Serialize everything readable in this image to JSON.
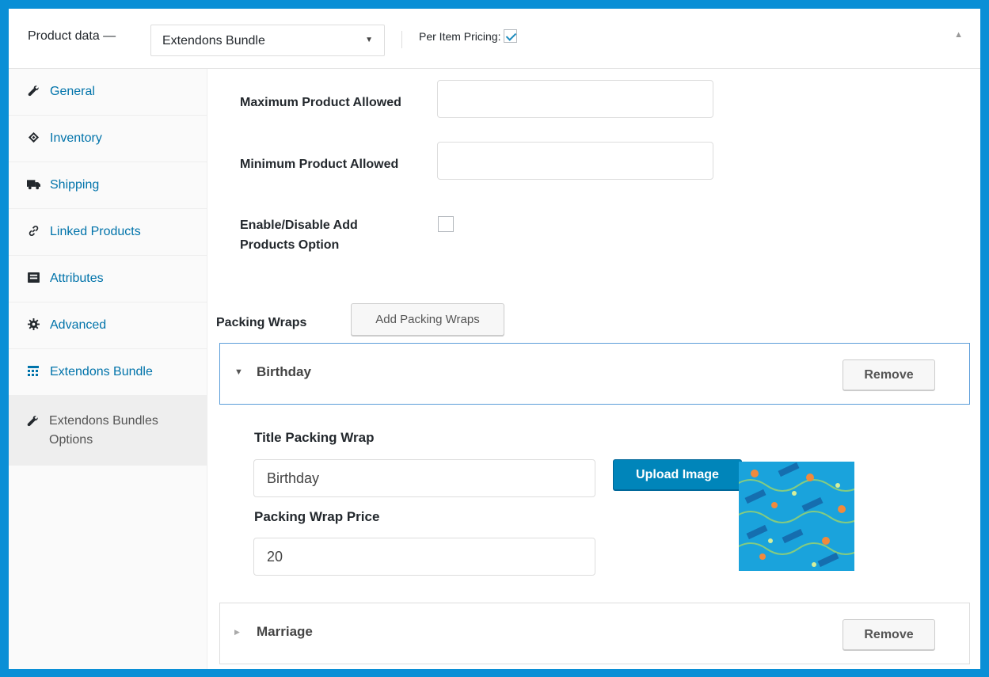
{
  "header": {
    "label": "Product data —",
    "product_type": "Extendons Bundle",
    "per_item_pricing_label": "Per Item Pricing:",
    "per_item_pricing_checked": true
  },
  "sidebar": {
    "items": [
      {
        "label": "General",
        "icon": "wrench-icon"
      },
      {
        "label": "Inventory",
        "icon": "tag-icon"
      },
      {
        "label": "Shipping",
        "icon": "truck-icon"
      },
      {
        "label": "Linked Products",
        "icon": "link-icon"
      },
      {
        "label": "Attributes",
        "icon": "list-card-icon"
      },
      {
        "label": "Advanced",
        "icon": "gear-icon"
      },
      {
        "label": "Extendons Bundle",
        "icon": "grid-icon"
      },
      {
        "label": "Extendons Bundles Options",
        "icon": "wrench-icon",
        "active": true
      }
    ]
  },
  "fields": {
    "max_label": "Maximum Product Allowed",
    "max_value": "",
    "min_label": "Minimum Product Allowed",
    "min_value": "",
    "enable_label": "Enable/Disable Add Products Option",
    "enable_checked": false
  },
  "packing": {
    "label": "Packing Wraps",
    "add_button": "Add Packing Wraps",
    "wraps": [
      {
        "title": "Birthday",
        "expanded": true,
        "remove_label": "Remove",
        "title_field_label": "Title Packing Wrap",
        "title_value": "Birthday",
        "price_label": "Packing Wrap Price",
        "price_value": "20",
        "upload_label": "Upload Image"
      },
      {
        "title": "Marriage",
        "expanded": false,
        "remove_label": "Remove"
      }
    ]
  },
  "colors": {
    "frame": "#0a8fd6",
    "link": "#0073aa",
    "primary_button": "#0085ba",
    "wrap_pattern": "#1aa3dc"
  }
}
